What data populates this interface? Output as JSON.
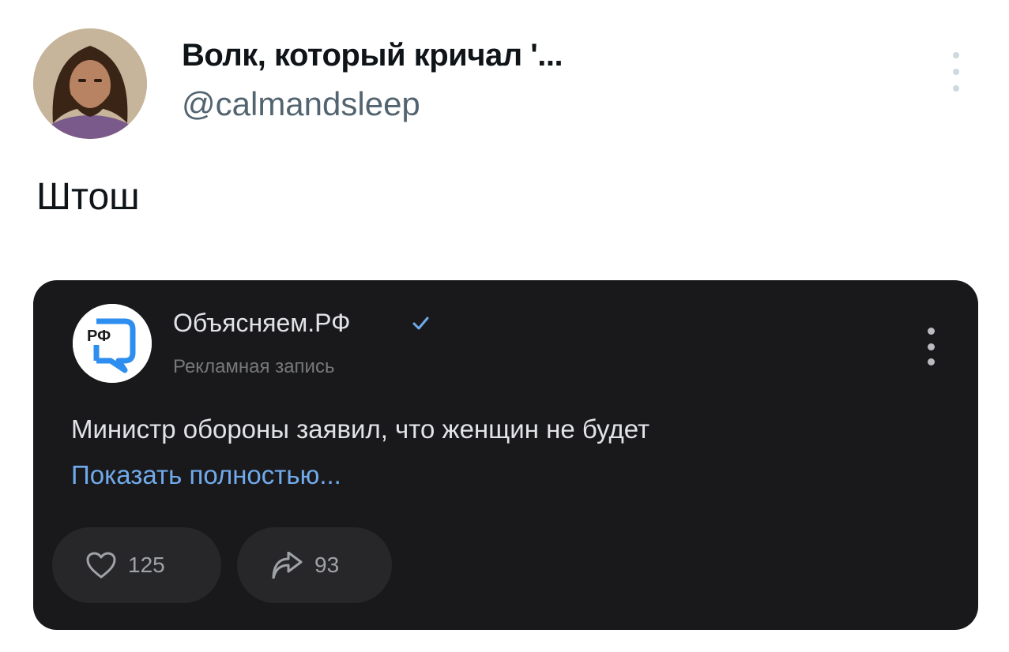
{
  "tweet": {
    "author_name": "Волк, который кричал '...",
    "author_handle": "@calmandsleep",
    "text": "Штош"
  },
  "embedded_post": {
    "source_name": "Объясняем.РФ",
    "source_logo_text": "РФ",
    "verified": true,
    "subtitle": "Рекламная запись",
    "text": "Министр обороны заявил, что женщин не будет",
    "show_more_label": "Показать полностью...",
    "likes": "125",
    "shares": "93",
    "colors": {
      "card_bg": "#19191b",
      "link": "#71aaeb",
      "logo_blue": "#2d8ef0"
    }
  },
  "icons": [
    "more-vertical-icon",
    "verified-check-icon",
    "heart-icon",
    "share-arrow-icon"
  ]
}
